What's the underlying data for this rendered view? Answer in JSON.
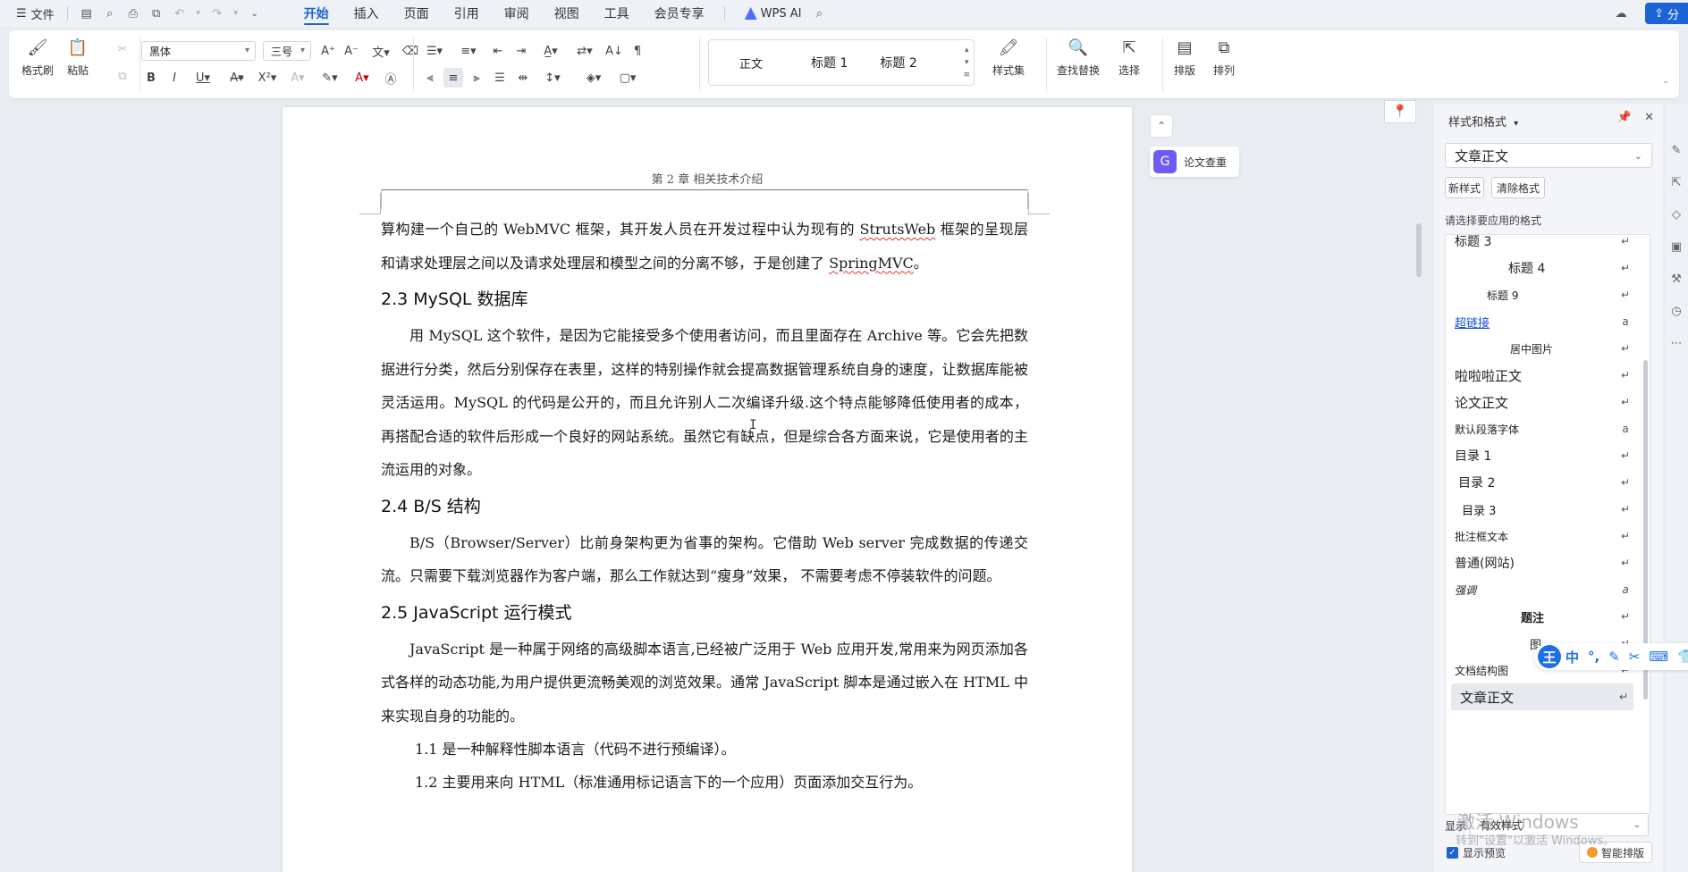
{
  "menubar": {
    "file_label": "文件",
    "tabs": [
      "开始",
      "插入",
      "页面",
      "引用",
      "审阅",
      "视图",
      "工具",
      "会员专享"
    ],
    "active_tab": "开始",
    "wps_ai": "WPS AI",
    "share_label": "分"
  },
  "ribbon": {
    "format_painter": "格式刷",
    "paste": "粘贴",
    "font_name": "黑体",
    "font_size": "三号",
    "styles": [
      "正文",
      "标题 1",
      "标题 2"
    ],
    "style_set": "样式集",
    "find_replace": "查找替换",
    "select": "选择",
    "layout": "排版",
    "arrange": "排列"
  },
  "document": {
    "running_head": "第 2 章  相关技术介绍",
    "blocks": [
      {
        "type": "para",
        "indent": false,
        "text": "算构建一个自己的 WebMVC 框架，其开发人员在开发过程中认为现有的 StrutsWeb 框架的呈现层和请求处理层之间以及请求处理层和模型之间的分离不够，于是创建了 SpringMVC。"
      },
      {
        "type": "heading",
        "text": "2.3  MySQL 数据库"
      },
      {
        "type": "para",
        "indent": true,
        "text": "用 MySQL 这个软件，是因为它能接受多个使用者访问，而且里面存在 Archive 等。它会先把数据进行分类，然后分别保存在表里，这样的特别操作就会提高数据管理系统自身的速度，让数据库能被灵活运用。MySQL 的代码是公开的，而且允许别人二次编译升级.这个特点能够降低使用者的成本，再搭配合适的软件后形成一个良好的网站系统。虽然它有缺点，但是综合各方面来说，它是使用者的主流运用的对象。"
      },
      {
        "type": "heading",
        "text": "2.4  B/S 结构"
      },
      {
        "type": "para",
        "indent": true,
        "text": "B/S（Browser/Server）比前身架构更为省事的架构。它借助 Web server 完成数据的传递交流。只需要下载浏览器作为客户端，那么工作就达到“瘦身”效果，  不需要考虑不停装软件的问题。"
      },
      {
        "type": "heading",
        "text": "2.5  JavaScript  运行模式"
      },
      {
        "type": "para",
        "indent": true,
        "text": "JavaScript 是一种属于网络的高级脚本语言,已经被广泛用于 Web 应用开发,常用来为网页添加各式各样的动态功能,为用户提供更流畅美观的浏览效果。通常 JavaScript 脚本是通过嵌入在 HTML 中来实现自身的功能的。"
      },
      {
        "type": "list",
        "text": "1.1 是一种解释性脚本语言（代码不进行预编译）。"
      },
      {
        "type": "list",
        "text": "1.2 主要用来向 HTML（标准通用标记语言下的一个应用）页面添加交互行为。"
      }
    ],
    "paper_check": "论文查重"
  },
  "panel": {
    "title": "样式和格式",
    "current_style": "文章正文",
    "new_style": "新样式",
    "clear_format": "清除格式",
    "apply_label": "请选择要应用的格式",
    "styles": [
      {
        "name": "标题 3",
        "mark": "↵"
      },
      {
        "name": "标题 4",
        "mark": "↵"
      },
      {
        "name": "标题 9",
        "mark": "↵"
      },
      {
        "name": "超链接",
        "mark": "a"
      },
      {
        "name": "居中图片",
        "mark": "↵"
      },
      {
        "name": "啦啦啦正文",
        "mark": "↵"
      },
      {
        "name": "论文正文",
        "mark": "↵"
      },
      {
        "name": "默认段落字体",
        "mark": "a"
      },
      {
        "name": "目录 1",
        "mark": "↵"
      },
      {
        "name": "目录 2",
        "mark": "↵"
      },
      {
        "name": "目录 3",
        "mark": "↵"
      },
      {
        "name": "批注框文本",
        "mark": "↵"
      },
      {
        "name": "普通(网站)",
        "mark": "↵"
      },
      {
        "name": "强调",
        "mark": "a"
      },
      {
        "name": "题注",
        "mark": "↵"
      },
      {
        "name": "图",
        "mark": "↵"
      },
      {
        "name": "文档结构图",
        "mark": "↵"
      },
      {
        "name": "文章正文",
        "mark": "↵"
      }
    ],
    "selected_style": "文章正文",
    "show_label": "显示",
    "show_value": "有效样式",
    "show_preview": "显示预览",
    "smart_layout": "智能排版"
  },
  "overlay": {
    "activate_windows": "激活 Windows",
    "activate_hint": "转到\"设置\"以激活 Windows。",
    "ime_items": [
      "中",
      "°,",
      "✎",
      "✂",
      "⌨",
      "👕"
    ]
  },
  "colors": {
    "accent": "#1c64d6",
    "link": "#1c4fd6",
    "paper_check": "#6d5bf4",
    "ime": "#1c6fe6"
  }
}
